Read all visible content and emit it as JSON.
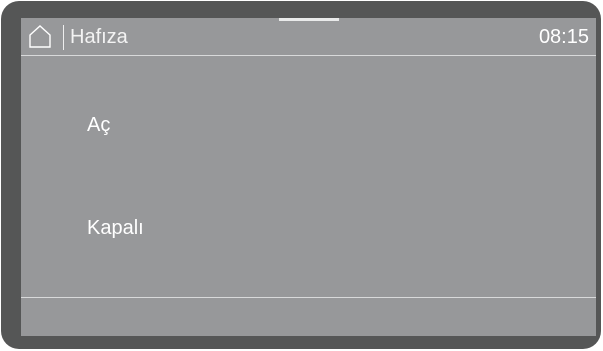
{
  "header": {
    "home_icon": "home-icon",
    "title": "Hafıza",
    "time": "08:15"
  },
  "options": [
    {
      "label": "Aç"
    },
    {
      "label": "Kapalı"
    }
  ],
  "colors": {
    "bezel": "#555656",
    "screen": "#97989a",
    "text": "#ffffff",
    "rule": "#d8d9da"
  }
}
